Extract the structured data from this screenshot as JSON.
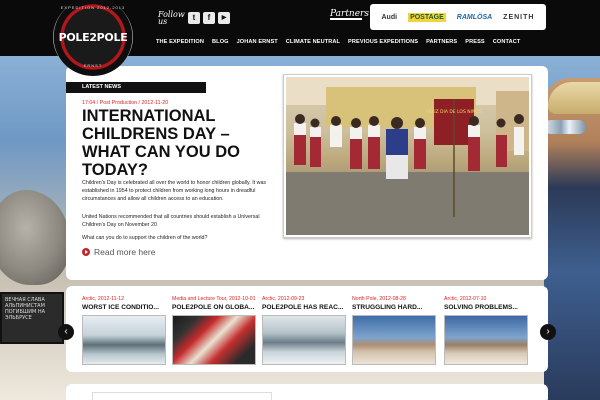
{
  "header": {
    "logo_text": "POLE2POLE",
    "logo_ring_top": "EXPEDITION 2012-2013",
    "logo_ring_bottom": "ERNST",
    "follow_text": "Follow us",
    "social": [
      {
        "icon": "twitter-icon",
        "glyph": "t"
      },
      {
        "icon": "facebook-icon",
        "glyph": "f"
      },
      {
        "icon": "youtube-icon",
        "glyph": "▶"
      }
    ],
    "partners_label": "Partners",
    "partners": [
      "Audi",
      "POSTAGE",
      "RAMLÖSA",
      "ZENITH"
    ]
  },
  "nav": [
    "THE EXPEDITION",
    "BLOG",
    "JOHAN ERNST",
    "CLIMATE NEUTRAL",
    "PREVIOUS EXPEDITIONS",
    "PARTNERS",
    "PRESS",
    "CONTACT"
  ],
  "featured": {
    "section_label": "LATEST NEWS",
    "meta": "17:04 / Post Production / 2012-11-20",
    "title": "INTERNATIONAL CHILDRENS DAY – WHAT CAN YOU DO TODAY?",
    "paragraphs": [
      "Children's Day is celebrated all over the world to honor children globally. It was established in 1954 to protect children from working long hours in dreadful circumstances and allow all children access to an education.",
      "United Nations recommended that all countries should establish a Universal Children's Day on November 20",
      "What can you do to support the children of the world?"
    ],
    "read_more": "Read more here",
    "banner_text": "FELIZ DIA DE LOS NIÑOS"
  },
  "thumbs": [
    {
      "meta": "Arctic, 2012-11-12",
      "title": "WORST ICE CONDITIO..."
    },
    {
      "meta": "Media and Lecture Tour, 2012-10-01",
      "title": "POLE2POLE ON GLOBA..."
    },
    {
      "meta": "Arctic, 2012-09-23",
      "title": "POLE2POLE HAS REAC..."
    },
    {
      "meta": "North Pole, 2012-08-28",
      "title": "STRUGGLING HARD..."
    },
    {
      "meta": "Arctic, 2012-07-10",
      "title": "SOLVING PROBLEMS..."
    }
  ],
  "background_sign": "ВЕЧНАЯ СЛАВА АЛЬПИНИСТАМ ПОГИБШИМ НА ЭЛЬБРУСЕ",
  "arrows": {
    "prev": "‹",
    "next": "›"
  }
}
